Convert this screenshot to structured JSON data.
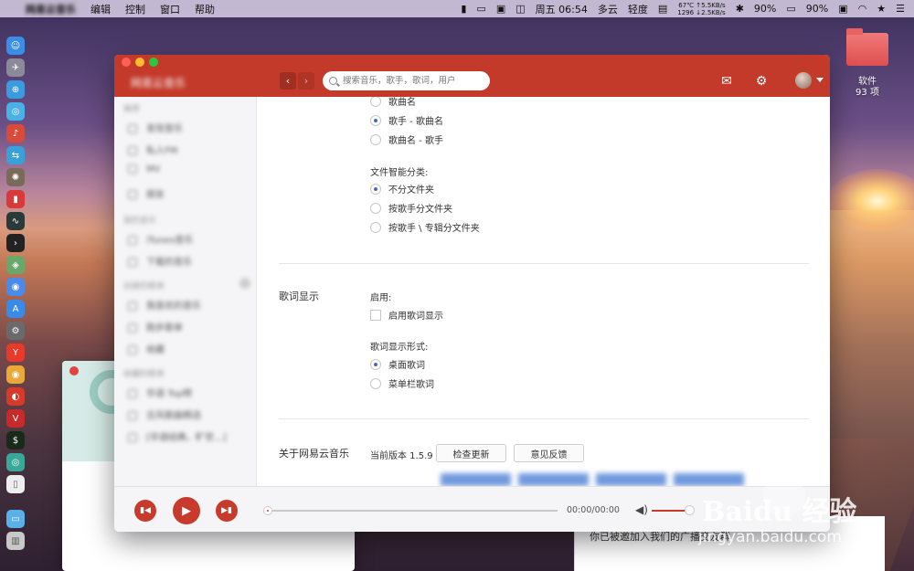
{
  "menubar": {
    "app_name": "网易云音乐",
    "items": [
      "编辑",
      "控制",
      "窗口",
      "帮助"
    ],
    "clock": "周五 06:54",
    "weather": "多云",
    "pollution": "轻度",
    "net_temp": "67℃",
    "net_up": "↑5.5KB/s",
    "net_fan": "1296",
    "net_down": "↓2.5KB/s",
    "battery_a": "90%",
    "battery_b": "90%"
  },
  "desktop": {
    "folder_name": "软件",
    "folder_count": "93 项"
  },
  "app": {
    "brand": "网易云音乐",
    "search_placeholder": "搜索音乐，歌手，歌词，用户",
    "sidebar": {
      "section_1": "推荐",
      "section_1_items": [
        "发现音乐",
        "私人FM",
        "MV",
        "朋友"
      ],
      "section_2": "我的音乐",
      "section_2_items": [
        "iTunes音乐",
        "下载的音乐"
      ],
      "section_3": "创建的歌单",
      "section_3_items": [
        "我喜欢的音乐",
        "跑步歌单",
        "收藏"
      ],
      "section_4": "收藏的歌单",
      "section_4_items": [
        "华语 Top榜",
        "古风歌曲精选",
        "[华语经典，旷世…]"
      ]
    }
  },
  "settings": {
    "naming_options": [
      {
        "label": "歌曲名",
        "selected": false
      },
      {
        "label": "歌手 - 歌曲名",
        "selected": true
      },
      {
        "label": "歌曲名 - 歌手",
        "selected": false
      }
    ],
    "classify_label": "文件智能分类:",
    "classify_options": [
      {
        "label": "不分文件夹",
        "selected": true
      },
      {
        "label": "按歌手分文件夹",
        "selected": false
      },
      {
        "label": "按歌手 \\ 专辑分文件夹",
        "selected": false
      }
    ],
    "lyrics_section": "歌词显示",
    "lyrics_enable_label": "启用:",
    "lyrics_enable_checkbox": "启用歌词显示",
    "lyrics_enable_checked": false,
    "lyrics_mode_label": "歌词显示形式:",
    "lyrics_mode_options": [
      {
        "label": "桌面歌词",
        "selected": true
      },
      {
        "label": "菜单栏歌词",
        "selected": false
      }
    ],
    "about_section": "关于网易云音乐",
    "version_text": "当前版本 1.5.9",
    "check_update": "检查更新",
    "feedback": "意见反馈"
  },
  "player": {
    "time": "00:00/00:00",
    "volume_level": 0.85,
    "progress": 0
  },
  "background_window": {
    "text": "你已被邀加入我们的广播交友群"
  },
  "watermark": {
    "brand": "Baidu 经验",
    "url": "jingyan.baidu.com"
  },
  "colors": {
    "accent": "#c33a2b",
    "radio_selected": "#3a6fc9"
  }
}
